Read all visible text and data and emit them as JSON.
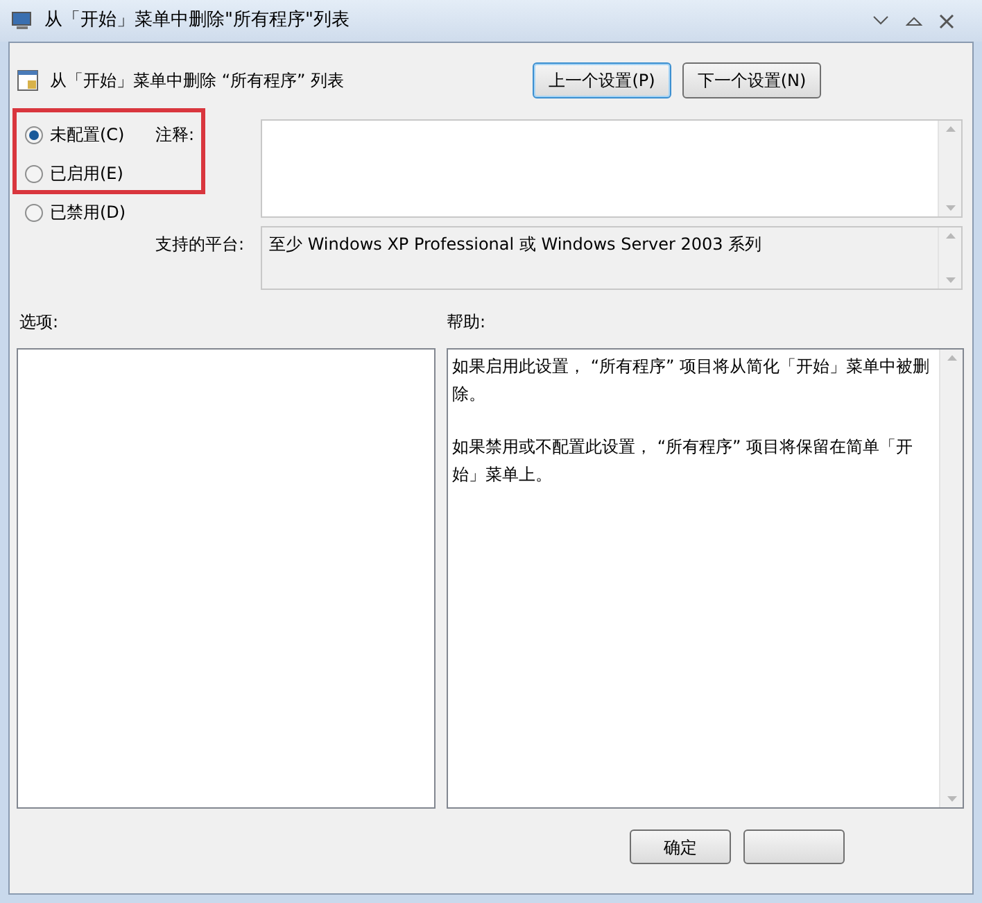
{
  "window": {
    "title": "从「开始」菜单中删除\"所有程序\"列表"
  },
  "header": {
    "title": "从「开始」菜单中删除 “所有程序” 列表"
  },
  "nav_buttons": [
    {
      "label": "上一个设置(P)",
      "focused": true
    },
    {
      "label": "下一个设置(N)",
      "focused": false
    }
  ],
  "states": [
    {
      "label": "未配置(C)",
      "selected": true
    },
    {
      "label": "已启用(E)",
      "selected": false
    },
    {
      "label": "已禁用(D)",
      "selected": false
    }
  ],
  "comment": {
    "label": "注释:"
  },
  "platform": {
    "label": "支持的平台:",
    "value": "至少 Windows XP Professional 或 Windows Server 2003 系列"
  },
  "options": {
    "label": "选项:"
  },
  "help": {
    "label": "帮助:",
    "paragraphs": [
      "如果启用此设置， “所有程序” 项目将从简化「开始」菜单中被删除。",
      "如果禁用或不配置此设置， “所有程序” 项目将保留在简单「开始」菜单上。"
    ]
  },
  "footer_buttons": [
    {
      "label": "确定"
    }
  ]
}
